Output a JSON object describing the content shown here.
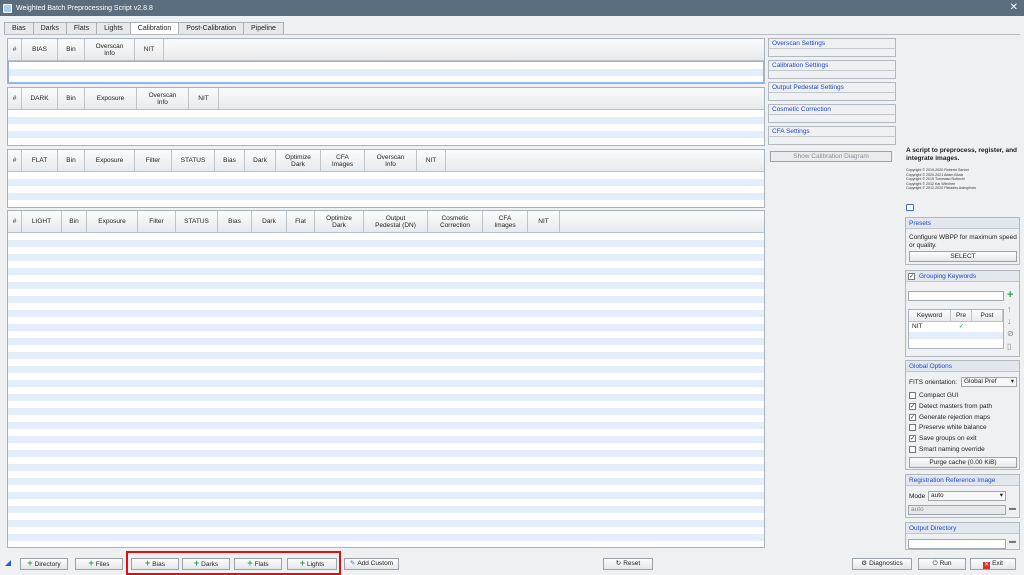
{
  "window": {
    "title": "Weighted Batch Preprocessing Script v2.8.8",
    "close_glyph": "✕"
  },
  "tabs": [
    "Bias",
    "Darks",
    "Flats",
    "Lights",
    "Calibration",
    "Post-Calibration",
    "Pipeline"
  ],
  "active_tab": "Calibration",
  "tables": {
    "bias": {
      "headers": [
        "#",
        "BIAS",
        "Bin",
        "Overscan\nInfo",
        "NIT"
      ]
    },
    "dark": {
      "headers": [
        "#",
        "DARK",
        "Bin",
        "Exposure",
        "Overscan\nInfo",
        "NIT"
      ]
    },
    "flat": {
      "headers": [
        "#",
        "FLAT",
        "Bin",
        "Exposure",
        "Filter",
        "STATUS",
        "Bias",
        "Dark",
        "Optimize\nDark",
        "CFA\nImages",
        "Overscan\nInfo",
        "NIT"
      ]
    },
    "light": {
      "headers": [
        "#",
        "LIGHT",
        "Bin",
        "Exposure",
        "Filter",
        "STATUS",
        "Bias",
        "Dark",
        "Flat",
        "Optimize\nDark",
        "Output\nPedestal (DN)",
        "Cosmetic\nCorrection",
        "CFA\nImages",
        "NIT"
      ]
    }
  },
  "side_sections": [
    "Overscan Settings",
    "Calibration Settings",
    "Output Pedestal Settings",
    "Cosmetic Correction",
    "CFA Settings"
  ],
  "show_calibration_diagram": "Show Calibration Diagram",
  "info": {
    "title": "A script to preprocess, register, and integrate images.",
    "copyrights": [
      "Copyright © 2019-2020 Roberto Sartori",
      "Copyright © 2020-2021 Adam Block",
      "Copyright © 2019 Tommaso Rubechi",
      "Copyright © 2012 Kai Wiechen",
      "Copyright © 2012-2020 Pleiades Astrophoto"
    ]
  },
  "presets": {
    "header": "Presets",
    "text": "Configure WBPP for maximum speed or quality.",
    "select": "SELECT"
  },
  "grouping": {
    "header": "Grouping Keywords",
    "checked": true,
    "headers": [
      "Keyword",
      "Pre",
      "Post"
    ],
    "rows": [
      {
        "keyword": "NIT",
        "pre": "✓",
        "post": ""
      }
    ]
  },
  "global": {
    "header": "Global Options",
    "fits_label": "FITS orientation:",
    "fits_value": "Global Pref",
    "options": [
      {
        "label": "Compact GUI",
        "checked": false
      },
      {
        "label": "Detect masters from path",
        "checked": true
      },
      {
        "label": "Generate rejection maps",
        "checked": true
      },
      {
        "label": "Preserve white balance",
        "checked": false
      },
      {
        "label": "Save groups on exit",
        "checked": true
      },
      {
        "label": "Smart naming override",
        "checked": false
      }
    ],
    "purge": "Purge cache (0.00 KiB)"
  },
  "registration": {
    "header": "Registration Reference Image",
    "mode_label": "Mode",
    "mode_value": "auto",
    "ref_value": "auto"
  },
  "output": {
    "header": "Output Directory"
  },
  "bottom": {
    "directory": "Directory",
    "files": "Files",
    "bias": "Bias",
    "darks": "Darks",
    "flats": "Flats",
    "lights": "Lights",
    "add_custom": "Add Custom",
    "reset": "Reset",
    "diagnostics": "Diagnostics",
    "run": "Run",
    "exit": "Exit"
  }
}
